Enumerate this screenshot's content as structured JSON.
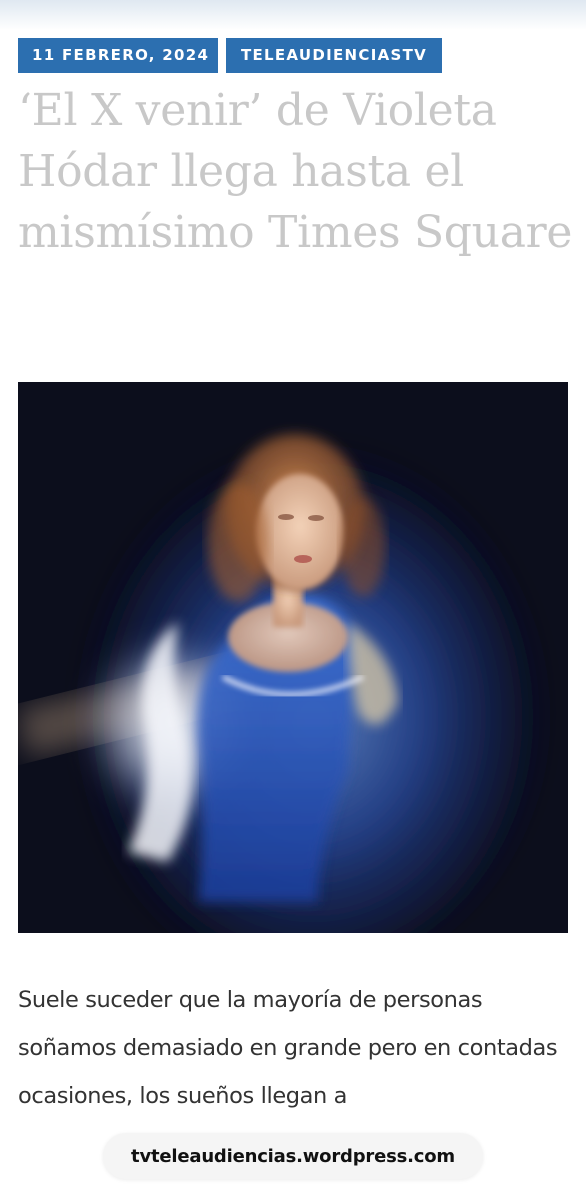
{
  "post": {
    "date": "11 FEBRERO, 2024",
    "category": "TELEAUDIENCIASTV",
    "title": "‘El X venir’ de Violeta Hódar llega hasta el mismísimo Times Square",
    "body": "Suele suceder que la mayoría de personas soñamos demasiado en grande pero en contadas ocasiones, los sueños llegan a"
  },
  "browser": {
    "url": "tvteleaudiencias.wordpress.com"
  },
  "colors": {
    "badge": "#2c6fb0",
    "title": "#c8c8c8",
    "body_text": "#333333"
  }
}
